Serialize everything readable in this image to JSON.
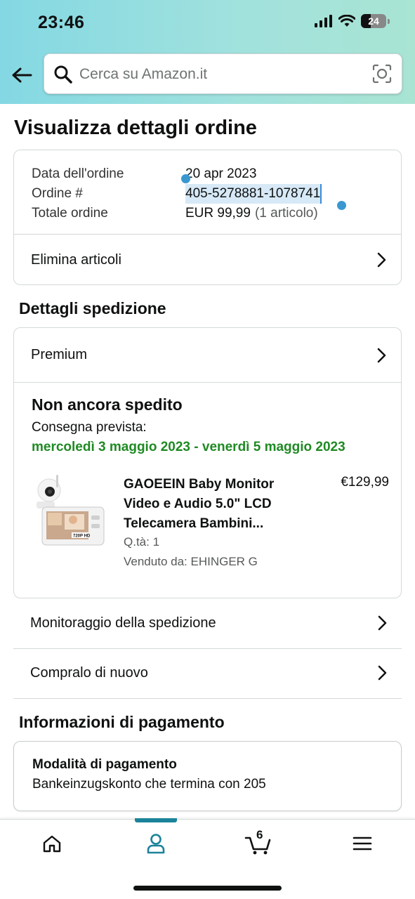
{
  "status_bar": {
    "time": "23:46",
    "battery": "24"
  },
  "search": {
    "placeholder": "Cerca su Amazon.it"
  },
  "page": {
    "title": "Visualizza dettagli ordine"
  },
  "order": {
    "date_label": "Data dell'ordine",
    "date_value": "20 apr 2023",
    "number_label": "Ordine #",
    "number_value": "405-5278881-1078741",
    "total_label": "Totale ordine",
    "total_value": "EUR 99,99",
    "total_items": "(1 articolo)",
    "remove_items_label": "Elimina articoli"
  },
  "shipping": {
    "section_title": "Dettagli spedizione",
    "premium_label": "Premium",
    "status": "Non ancora spedito",
    "expected_label": "Consegna prevista:",
    "expected_dates": "mercoledì 3 maggio 2023 - venerdì 5 maggio 2023",
    "product": {
      "title": "GAOEEIN Baby Monitor Video e Audio 5.0\" LCD Telecamera Bambini...",
      "price": "€129,99",
      "qty": "Q.tà: 1",
      "seller": "Venduto da: EHINGER G",
      "image_badge": "720P HD"
    },
    "track_label": "Monitoraggio della spedizione",
    "buy_again_label": "Compralo di nuovo"
  },
  "payment": {
    "section_title": "Informazioni di pagamento",
    "method_title": "Modalità di pagamento",
    "method_text": "Bankeinzugskonto che termina con 205"
  },
  "bottom_nav": {
    "cart_count": "6"
  },
  "colors": {
    "accent": "#1b8399",
    "delivery_green": "#1f8a23",
    "selection": "#3a98d0"
  }
}
